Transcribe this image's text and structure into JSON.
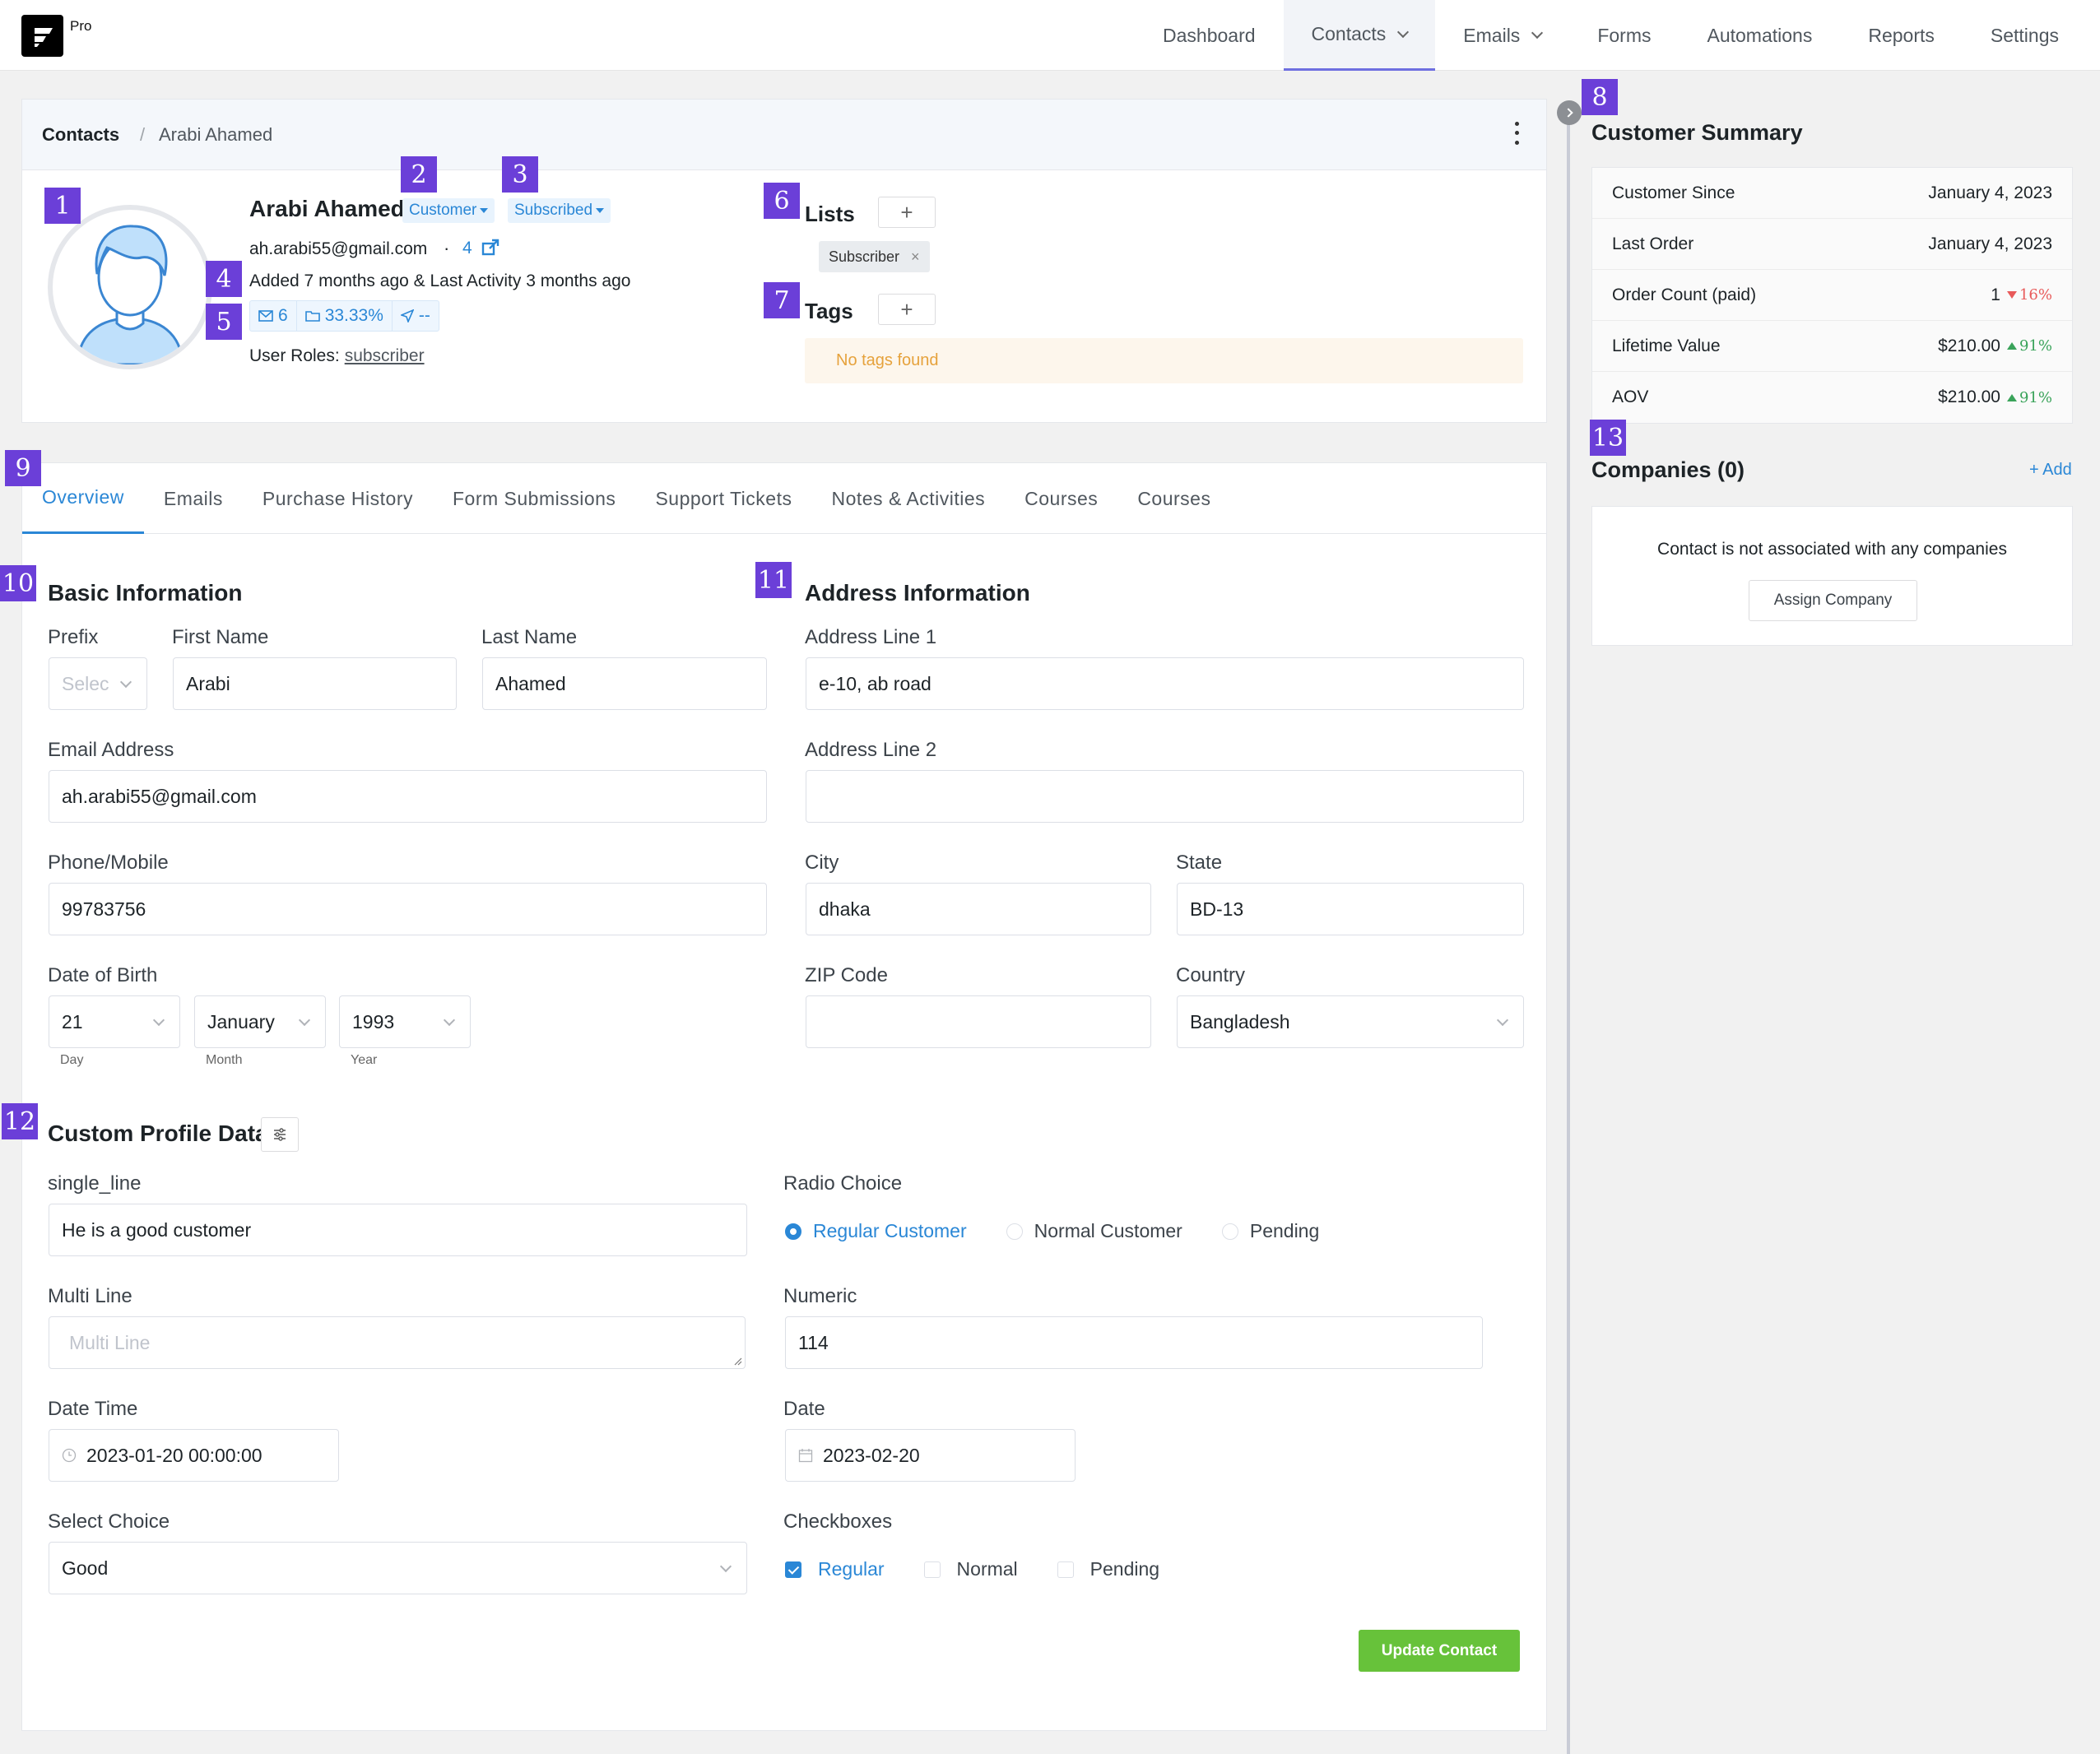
{
  "app": {
    "logo_suffix": "Pro"
  },
  "nav": {
    "items": [
      {
        "label": "Dashboard"
      },
      {
        "label": "Contacts"
      },
      {
        "label": "Emails"
      },
      {
        "label": "Forms"
      },
      {
        "label": "Automations"
      },
      {
        "label": "Reports"
      },
      {
        "label": "Settings"
      }
    ],
    "active": "Contacts"
  },
  "breadcrumb": {
    "root": "Contacts",
    "separator": "/",
    "current": "Arabi Ahamed"
  },
  "contact": {
    "name": "Arabi Ahamed",
    "type_label": "Customer",
    "status_label": "Subscribed",
    "email": "ah.arabi55@gmail.com",
    "separator": "·",
    "email_count": "4",
    "activity": "Added 7 months ago & Last Activity 3 months ago",
    "stats": {
      "emails": "6",
      "open_rate": "33.33%",
      "click": "--"
    },
    "roles_label": "User Roles:",
    "role": "subscriber"
  },
  "lists": {
    "title": "Lists",
    "items": [
      {
        "label": "Subscriber",
        "remove": "×"
      }
    ],
    "add": "+"
  },
  "tags": {
    "title": "Tags",
    "empty": "No tags found",
    "add": "+"
  },
  "tabs": [
    {
      "label": "Overview"
    },
    {
      "label": "Emails"
    },
    {
      "label": "Purchase History"
    },
    {
      "label": "Form Submissions"
    },
    {
      "label": "Support Tickets"
    },
    {
      "label": "Notes & Activities"
    },
    {
      "label": "Courses"
    },
    {
      "label": "Courses"
    }
  ],
  "basic": {
    "title": "Basic Information",
    "prefix": {
      "label": "Prefix",
      "placeholder": "Selec"
    },
    "first_name": {
      "label": "First Name",
      "value": "Arabi"
    },
    "last_name": {
      "label": "Last Name",
      "value": "Ahamed"
    },
    "email": {
      "label": "Email Address",
      "value": "ah.arabi55@gmail.com"
    },
    "phone": {
      "label": "Phone/Mobile",
      "value": "99783756"
    },
    "dob": {
      "label": "Date of Birth",
      "day": "21",
      "day_label": "Day",
      "month": "January",
      "month_label": "Month",
      "year": "1993",
      "year_label": "Year"
    }
  },
  "address": {
    "title": "Address Information",
    "line1": {
      "label": "Address Line 1",
      "value": "e-10, ab road"
    },
    "line2": {
      "label": "Address Line 2",
      "value": ""
    },
    "city": {
      "label": "City",
      "value": "dhaka"
    },
    "state": {
      "label": "State",
      "value": "BD-13"
    },
    "zip": {
      "label": "ZIP Code",
      "value": ""
    },
    "country": {
      "label": "Country",
      "value": "Bangladesh"
    }
  },
  "custom": {
    "title": "Custom Profile Data",
    "single_line": {
      "label": "single_line",
      "value": "He is a good customer"
    },
    "radio": {
      "label": "Radio Choice",
      "options": [
        "Regular Customer",
        "Normal Customer",
        "Pending"
      ],
      "selected": "Regular Customer"
    },
    "multi_line": {
      "label": "Multi Line",
      "placeholder": "Multi Line"
    },
    "numeric": {
      "label": "Numeric",
      "value": "114"
    },
    "date_time": {
      "label": "Date Time",
      "value": "2023-01-20 00:00:00"
    },
    "date": {
      "label": "Date",
      "value": "2023-02-20"
    },
    "select": {
      "label": "Select Choice",
      "value": "Good"
    },
    "checkboxes": {
      "label": "Checkboxes",
      "options": [
        "Regular",
        "Normal",
        "Pending"
      ],
      "checked": [
        "Regular"
      ]
    }
  },
  "update_button": "Update Contact",
  "summary": {
    "title": "Customer Summary",
    "rows": [
      {
        "label": "Customer Since",
        "value": "January 4, 2023",
        "delta": "",
        "dir": ""
      },
      {
        "label": "Last Order",
        "value": "January 4, 2023",
        "delta": "",
        "dir": ""
      },
      {
        "label": "Order Count (paid)",
        "value": "1",
        "delta": "16%",
        "dir": "down"
      },
      {
        "label": "Lifetime Value",
        "value": "$210.00",
        "delta": "91%",
        "dir": "up"
      },
      {
        "label": "AOV",
        "value": "$210.00",
        "delta": "91%",
        "dir": "up"
      }
    ]
  },
  "companies": {
    "title": "Companies (0)",
    "add": "+ Add",
    "empty": "Contact is not associated with any companies",
    "assign": "Assign Company"
  },
  "callouts": [
    "1",
    "2",
    "3",
    "4",
    "5",
    "6",
    "7",
    "8",
    "9",
    "10",
    "11",
    "12",
    "13"
  ],
  "colors": {
    "accent": "#2a87d6",
    "callout": "#6b3fd8",
    "success": "#67c23a",
    "nav_active": "#6e6fe0"
  }
}
